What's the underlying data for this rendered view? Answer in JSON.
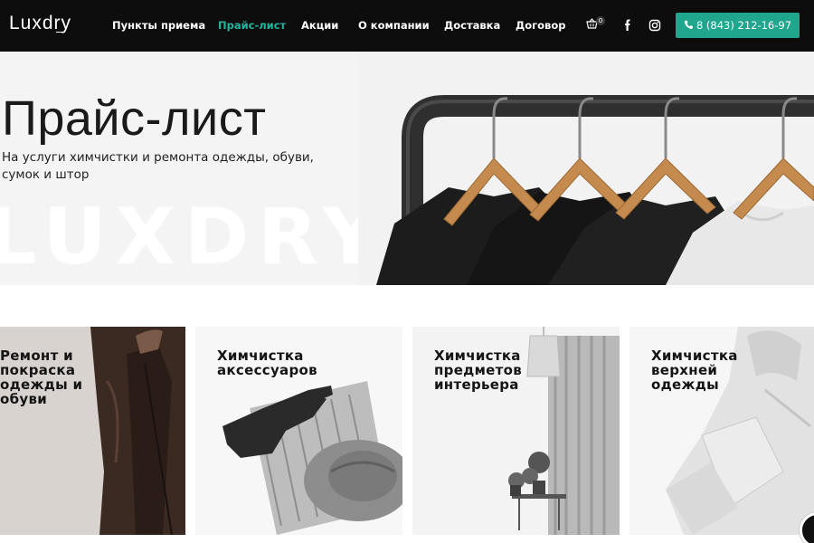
{
  "header": {
    "logo": "Luxdry",
    "nav": [
      {
        "label": "Пункты приема",
        "active": false
      },
      {
        "label": "Прайс-лист",
        "active": true
      },
      {
        "label": "Акции",
        "active": false
      },
      {
        "label": "О компании",
        "active": false
      },
      {
        "label": "Доставка",
        "active": false
      },
      {
        "label": "Договор",
        "active": false
      }
    ],
    "cart_count": "0",
    "social_icons": [
      "facebook-icon",
      "instagram-icon"
    ],
    "phone": "8 (843) 212-16-97",
    "accent_color": "#20a68d"
  },
  "hero": {
    "title": "Прайс-лист",
    "subtitle": "На услуги химчистки и ремонта одежды, обуви, сумок и штор",
    "watermark": "LUXDRY"
  },
  "cards": [
    {
      "title": "Ремонт и покраска одежды и обуви"
    },
    {
      "title": "Химчистка аксессуаров"
    },
    {
      "title": "Химчистка предметов интерьера"
    },
    {
      "title": "Химчистка верхней одежды"
    }
  ]
}
